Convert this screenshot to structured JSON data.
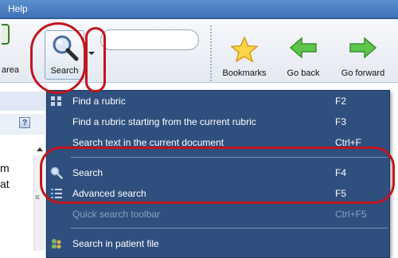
{
  "menubar": {
    "help_label": "Help"
  },
  "toolbar": {
    "area_label": "area",
    "search_label": "Search",
    "search_input_value": "",
    "bookmarks_label": "Bookmarks",
    "go_back_label": "Go back",
    "go_forward_label": "Go forward"
  },
  "left_pane": {
    "text_line1": "m",
    "text_line2": "at"
  },
  "search_menu": {
    "items": [
      {
        "label": "Find a rubric",
        "shortcut": "F2",
        "icon": "rubric-icon",
        "enabled": true
      },
      {
        "label": "Find a rubric starting from the current rubric",
        "shortcut": "F3",
        "icon": "",
        "enabled": true
      },
      {
        "label": "Search text in the current document",
        "shortcut": "Ctrl+F",
        "icon": "",
        "enabled": true
      },
      {
        "label": "Search",
        "shortcut": "F4",
        "icon": "magnifier-icon",
        "enabled": true
      },
      {
        "label": "Advanced search",
        "shortcut": "F5",
        "icon": "list-icon",
        "enabled": true
      },
      {
        "label": "Quick search toolbar",
        "shortcut": "Ctrl+F5",
        "icon": "",
        "enabled": false
      },
      {
        "label": "Search in patient file",
        "shortcut": "",
        "icon": "patient-file-icon",
        "enabled": true
      }
    ]
  },
  "colors": {
    "menu_bg": "#2f4f7e",
    "annotation": "#c0161d",
    "title_bar": "#4a80c4"
  }
}
